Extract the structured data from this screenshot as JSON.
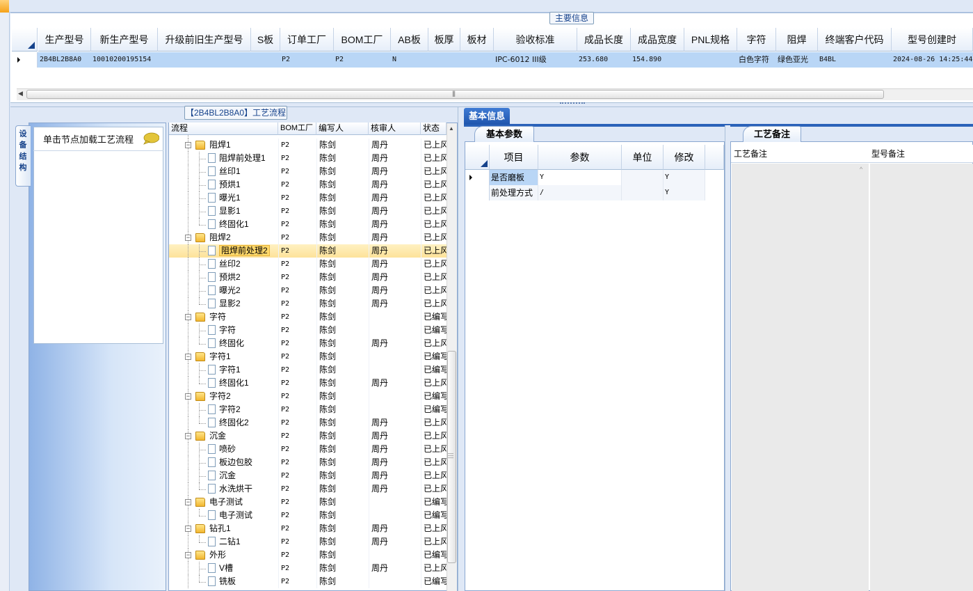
{
  "main_info": {
    "title": "主要信息",
    "columns": [
      "生产型号",
      "新生产型号",
      "升级前旧生产型号",
      "S板",
      "订单工厂",
      "BOM工厂",
      "AB板",
      "板厚",
      "板材",
      "验收标准",
      "成品长度",
      "成品宽度",
      "PNL规格",
      "字符",
      "阻焊",
      "终端客户代码",
      "型号创建时"
    ],
    "row": [
      "2B4BL2B8A0",
      "10010200195154",
      "",
      "",
      "P2",
      "P2",
      "N",
      "",
      "",
      "IPC-6012 III级",
      "253.680",
      "154.890",
      "",
      "白色字符",
      "绿色亚光",
      "B4BL",
      "2024-08-26 14:25:44"
    ]
  },
  "left_tab": {
    "label": "设 备 结 构",
    "hint": "单击节点加载工艺流程"
  },
  "flow": {
    "title": "【2B4BL2B8A0】工艺流程",
    "columns": [
      "流程",
      "BOM工厂",
      "编写人",
      "核审人",
      "状态"
    ],
    "rows": [
      {
        "level": 1,
        "type": "folder",
        "name": "阻焊1",
        "bom": "P2",
        "writer": "陈剑",
        "reviewer": "周丹",
        "status": "已上风"
      },
      {
        "level": 2,
        "type": "doc",
        "name": "阻焊前处理1",
        "bom": "P2",
        "writer": "陈剑",
        "reviewer": "周丹",
        "status": "已上风"
      },
      {
        "level": 2,
        "type": "doc",
        "name": "丝印1",
        "bom": "P2",
        "writer": "陈剑",
        "reviewer": "周丹",
        "status": "已上风"
      },
      {
        "level": 2,
        "type": "doc",
        "name": "预烘1",
        "bom": "P2",
        "writer": "陈剑",
        "reviewer": "周丹",
        "status": "已上风"
      },
      {
        "level": 2,
        "type": "doc",
        "name": "曝光1",
        "bom": "P2",
        "writer": "陈剑",
        "reviewer": "周丹",
        "status": "已上风"
      },
      {
        "level": 2,
        "type": "doc",
        "name": "显影1",
        "bom": "P2",
        "writer": "陈剑",
        "reviewer": "周丹",
        "status": "已上风"
      },
      {
        "level": 2,
        "type": "doc",
        "name": "终固化1",
        "bom": "P2",
        "writer": "陈剑",
        "reviewer": "周丹",
        "status": "已上风"
      },
      {
        "level": 1,
        "type": "folder",
        "name": "阻焊2",
        "bom": "P2",
        "writer": "陈剑",
        "reviewer": "周丹",
        "status": "已上风"
      },
      {
        "level": 2,
        "type": "doc",
        "name": "阻焊前处理2",
        "bom": "P2",
        "writer": "陈剑",
        "reviewer": "周丹",
        "status": "已上风",
        "selected": true
      },
      {
        "level": 2,
        "type": "doc",
        "name": "丝印2",
        "bom": "P2",
        "writer": "陈剑",
        "reviewer": "周丹",
        "status": "已上风"
      },
      {
        "level": 2,
        "type": "doc",
        "name": "预烘2",
        "bom": "P2",
        "writer": "陈剑",
        "reviewer": "周丹",
        "status": "已上风"
      },
      {
        "level": 2,
        "type": "doc",
        "name": "曝光2",
        "bom": "P2",
        "writer": "陈剑",
        "reviewer": "周丹",
        "status": "已上风"
      },
      {
        "level": 2,
        "type": "doc",
        "name": "显影2",
        "bom": "P2",
        "writer": "陈剑",
        "reviewer": "周丹",
        "status": "已上风"
      },
      {
        "level": 1,
        "type": "folder",
        "name": "字符",
        "bom": "P2",
        "writer": "陈剑",
        "reviewer": "",
        "status": "已编写"
      },
      {
        "level": 2,
        "type": "doc",
        "name": "字符",
        "bom": "P2",
        "writer": "陈剑",
        "reviewer": "",
        "status": "已编写"
      },
      {
        "level": 2,
        "type": "doc",
        "name": "终固化",
        "bom": "P2",
        "writer": "陈剑",
        "reviewer": "周丹",
        "status": "已上风"
      },
      {
        "level": 1,
        "type": "folder",
        "name": "字符1",
        "bom": "P2",
        "writer": "陈剑",
        "reviewer": "",
        "status": "已编写"
      },
      {
        "level": 2,
        "type": "doc",
        "name": "字符1",
        "bom": "P2",
        "writer": "陈剑",
        "reviewer": "",
        "status": "已编写"
      },
      {
        "level": 2,
        "type": "doc",
        "name": "终固化1",
        "bom": "P2",
        "writer": "陈剑",
        "reviewer": "周丹",
        "status": "已上风"
      },
      {
        "level": 1,
        "type": "folder",
        "name": "字符2",
        "bom": "P2",
        "writer": "陈剑",
        "reviewer": "",
        "status": "已编写"
      },
      {
        "level": 2,
        "type": "doc",
        "name": "字符2",
        "bom": "P2",
        "writer": "陈剑",
        "reviewer": "",
        "status": "已编写"
      },
      {
        "level": 2,
        "type": "doc",
        "name": "终固化2",
        "bom": "P2",
        "writer": "陈剑",
        "reviewer": "周丹",
        "status": "已上风"
      },
      {
        "level": 1,
        "type": "folder",
        "name": "沉金",
        "bom": "P2",
        "writer": "陈剑",
        "reviewer": "周丹",
        "status": "已上风"
      },
      {
        "level": 2,
        "type": "doc",
        "name": "喷砂",
        "bom": "P2",
        "writer": "陈剑",
        "reviewer": "周丹",
        "status": "已上风"
      },
      {
        "level": 2,
        "type": "doc",
        "name": "板边包胶",
        "bom": "P2",
        "writer": "陈剑",
        "reviewer": "周丹",
        "status": "已上风"
      },
      {
        "level": 2,
        "type": "doc",
        "name": "沉金",
        "bom": "P2",
        "writer": "陈剑",
        "reviewer": "周丹",
        "status": "已上风"
      },
      {
        "level": 2,
        "type": "doc",
        "name": "水洗烘干",
        "bom": "P2",
        "writer": "陈剑",
        "reviewer": "周丹",
        "status": "已上风"
      },
      {
        "level": 1,
        "type": "folder",
        "name": "电子测试",
        "bom": "P2",
        "writer": "陈剑",
        "reviewer": "",
        "status": "已编写"
      },
      {
        "level": 2,
        "type": "doc",
        "name": "电子测试",
        "bom": "P2",
        "writer": "陈剑",
        "reviewer": "",
        "status": "已编写"
      },
      {
        "level": 1,
        "type": "folder",
        "name": "钻孔1",
        "bom": "P2",
        "writer": "陈剑",
        "reviewer": "周丹",
        "status": "已上风"
      },
      {
        "level": 2,
        "type": "doc",
        "name": "二钻1",
        "bom": "P2",
        "writer": "陈剑",
        "reviewer": "周丹",
        "status": "已上风"
      },
      {
        "level": 1,
        "type": "folder",
        "name": "外形",
        "bom": "P2",
        "writer": "陈剑",
        "reviewer": "",
        "status": "已编写"
      },
      {
        "level": 2,
        "type": "doc",
        "name": "V槽",
        "bom": "P2",
        "writer": "陈剑",
        "reviewer": "周丹",
        "status": "已上风"
      },
      {
        "level": 2,
        "type": "doc",
        "name": "铣板",
        "bom": "P2",
        "writer": "陈剑",
        "reviewer": "",
        "status": "已编写"
      }
    ]
  },
  "basic_info": {
    "tab": "基本信息",
    "params_tab": "基本参数",
    "columns": [
      "项目",
      "参数",
      "单位",
      "修改"
    ],
    "rows": [
      {
        "item": "是否磨板",
        "param": "Y",
        "unit": "",
        "modify": "Y"
      },
      {
        "item": "前处理方式",
        "param": "/",
        "unit": "",
        "modify": "Y"
      }
    ],
    "notes_tab": "工艺备注",
    "notes_columns": [
      "工艺备注",
      "型号备注"
    ]
  }
}
